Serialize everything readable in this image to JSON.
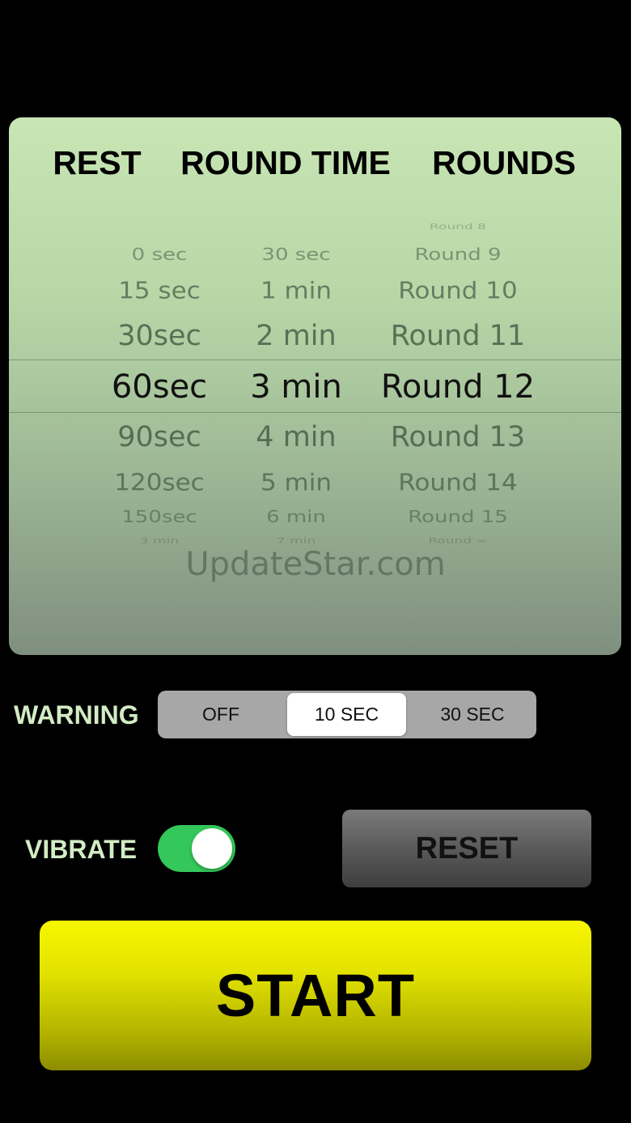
{
  "picker": {
    "headers": {
      "rest": "REST",
      "round_time": "ROUND TIME",
      "rounds": "ROUNDS"
    },
    "rest": {
      "items": [
        "0 sec",
        "15 sec",
        "30sec",
        "60sec",
        "90sec",
        "120sec",
        "150sec",
        "3 min"
      ],
      "selected": "60sec"
    },
    "round_time": {
      "items": [
        "30 sec",
        "1 min",
        "2 min",
        "3 min",
        "4 min",
        "5 min",
        "6 min",
        "7 min"
      ],
      "selected": "3 min"
    },
    "rounds": {
      "items": [
        "Round 8",
        "Round 9",
        "Round 10",
        "Round 11",
        "Round 12",
        "Round 13",
        "Round 14",
        "Round 15",
        "Round ∞"
      ],
      "selected": "Round 12"
    },
    "watermark": "UpdateStar.com"
  },
  "warning": {
    "label": "WARNING",
    "options": [
      "OFF",
      "10 SEC",
      "30 SEC"
    ],
    "selected": "10 SEC"
  },
  "vibrate": {
    "label": "VIBRATE",
    "on": true,
    "on_color": "#34c759"
  },
  "buttons": {
    "reset": "RESET",
    "start": "START"
  },
  "colors": {
    "background": "#000000",
    "label_green": "#d2ecc4",
    "start_yellow": "#f7f700"
  }
}
